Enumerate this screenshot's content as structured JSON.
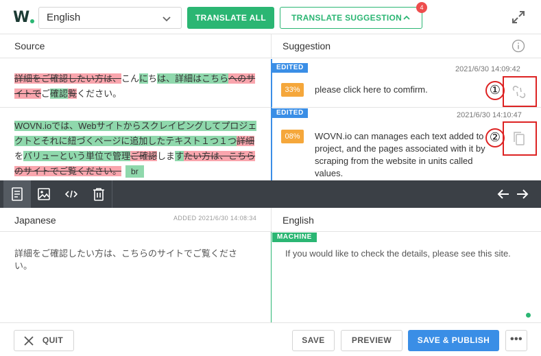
{
  "header": {
    "logo_text": "W",
    "language": "English",
    "translate_all": "TRANSLATE ALL",
    "translate_suggestion": "TRANSLATE SUGGESTION",
    "suggestion_count": "4"
  },
  "panels": {
    "source_title": "Source",
    "suggestion_title": "Suggestion"
  },
  "source_segments": [
    {
      "parts": [
        {
          "type": "del",
          "text": "詳細をご確認したい方は、"
        },
        {
          "type": "plain",
          "text": "こん"
        },
        {
          "type": "ins",
          "text": "に"
        },
        {
          "type": "plain",
          "text": "ち"
        },
        {
          "type": "ins",
          "text": "は、詳細はこちら"
        },
        {
          "type": "del",
          "text": "へのサイトで"
        },
        {
          "type": "plain",
          "text": "ご"
        },
        {
          "type": "ins",
          "text": "確認"
        },
        {
          "type": "del",
          "text": "覧"
        },
        {
          "type": "plain",
          "text": "ください。"
        }
      ]
    },
    {
      "parts": [
        {
          "type": "ins",
          "text": "WOVN.ioでは、Webサイトからスクレイピングしてプロジェクトとそれに紐づくページに追加したテキスト１つ１つ"
        },
        {
          "type": "del",
          "text": "詳細"
        },
        {
          "type": "plain",
          "text": "を"
        },
        {
          "type": "ins",
          "text": "バリューという単位で管理"
        },
        {
          "type": "del",
          "text": "ご確認"
        },
        {
          "type": "plain",
          "text": "しま"
        },
        {
          "type": "ins",
          "text": "す"
        },
        {
          "type": "del",
          "text": "たい方は、こちらのサイトでご覧ください。"
        },
        {
          "type": "plain",
          "text": ""
        }
      ],
      "tag": "br"
    }
  ],
  "suggestions": [
    {
      "status": "EDITED",
      "timestamp": "2021/6/30 14:09:42",
      "match": "33%",
      "text": "please click here to comfirm.",
      "marker": "①"
    },
    {
      "status": "EDITED",
      "timestamp": "2021/6/30 14:10:47",
      "match": "08%",
      "text": "WOVN.io can manages each text added to the project, and the pages associated with it by scraping from the website in units called values.",
      "marker": "②"
    }
  ],
  "toolbar": {
    "tools": [
      "document-icon",
      "image-icon",
      "code-icon",
      "trash-icon"
    ]
  },
  "original": {
    "language": "Japanese",
    "added": "ADDED 2021/6/30 14:08:34",
    "text": "詳細をご確認したい方は、こちらのサイトでご覧ください。"
  },
  "translation": {
    "language": "English",
    "badge": "MACHINE",
    "text": "If you would like to check the details, please see this site."
  },
  "footer": {
    "quit": "QUIT",
    "save": "SAVE",
    "preview": "PREVIEW",
    "publish": "SAVE & PUBLISH",
    "more": "•••"
  },
  "colors": {
    "brand_green": "#2bb673",
    "edited_blue": "#3a8ee6",
    "match_orange": "#f5a73b",
    "deletion_red": "#f9a5ad",
    "insertion_green": "#8fd8ac",
    "toolbar_dark": "#3b4046",
    "annotation_red": "#dd2222"
  }
}
